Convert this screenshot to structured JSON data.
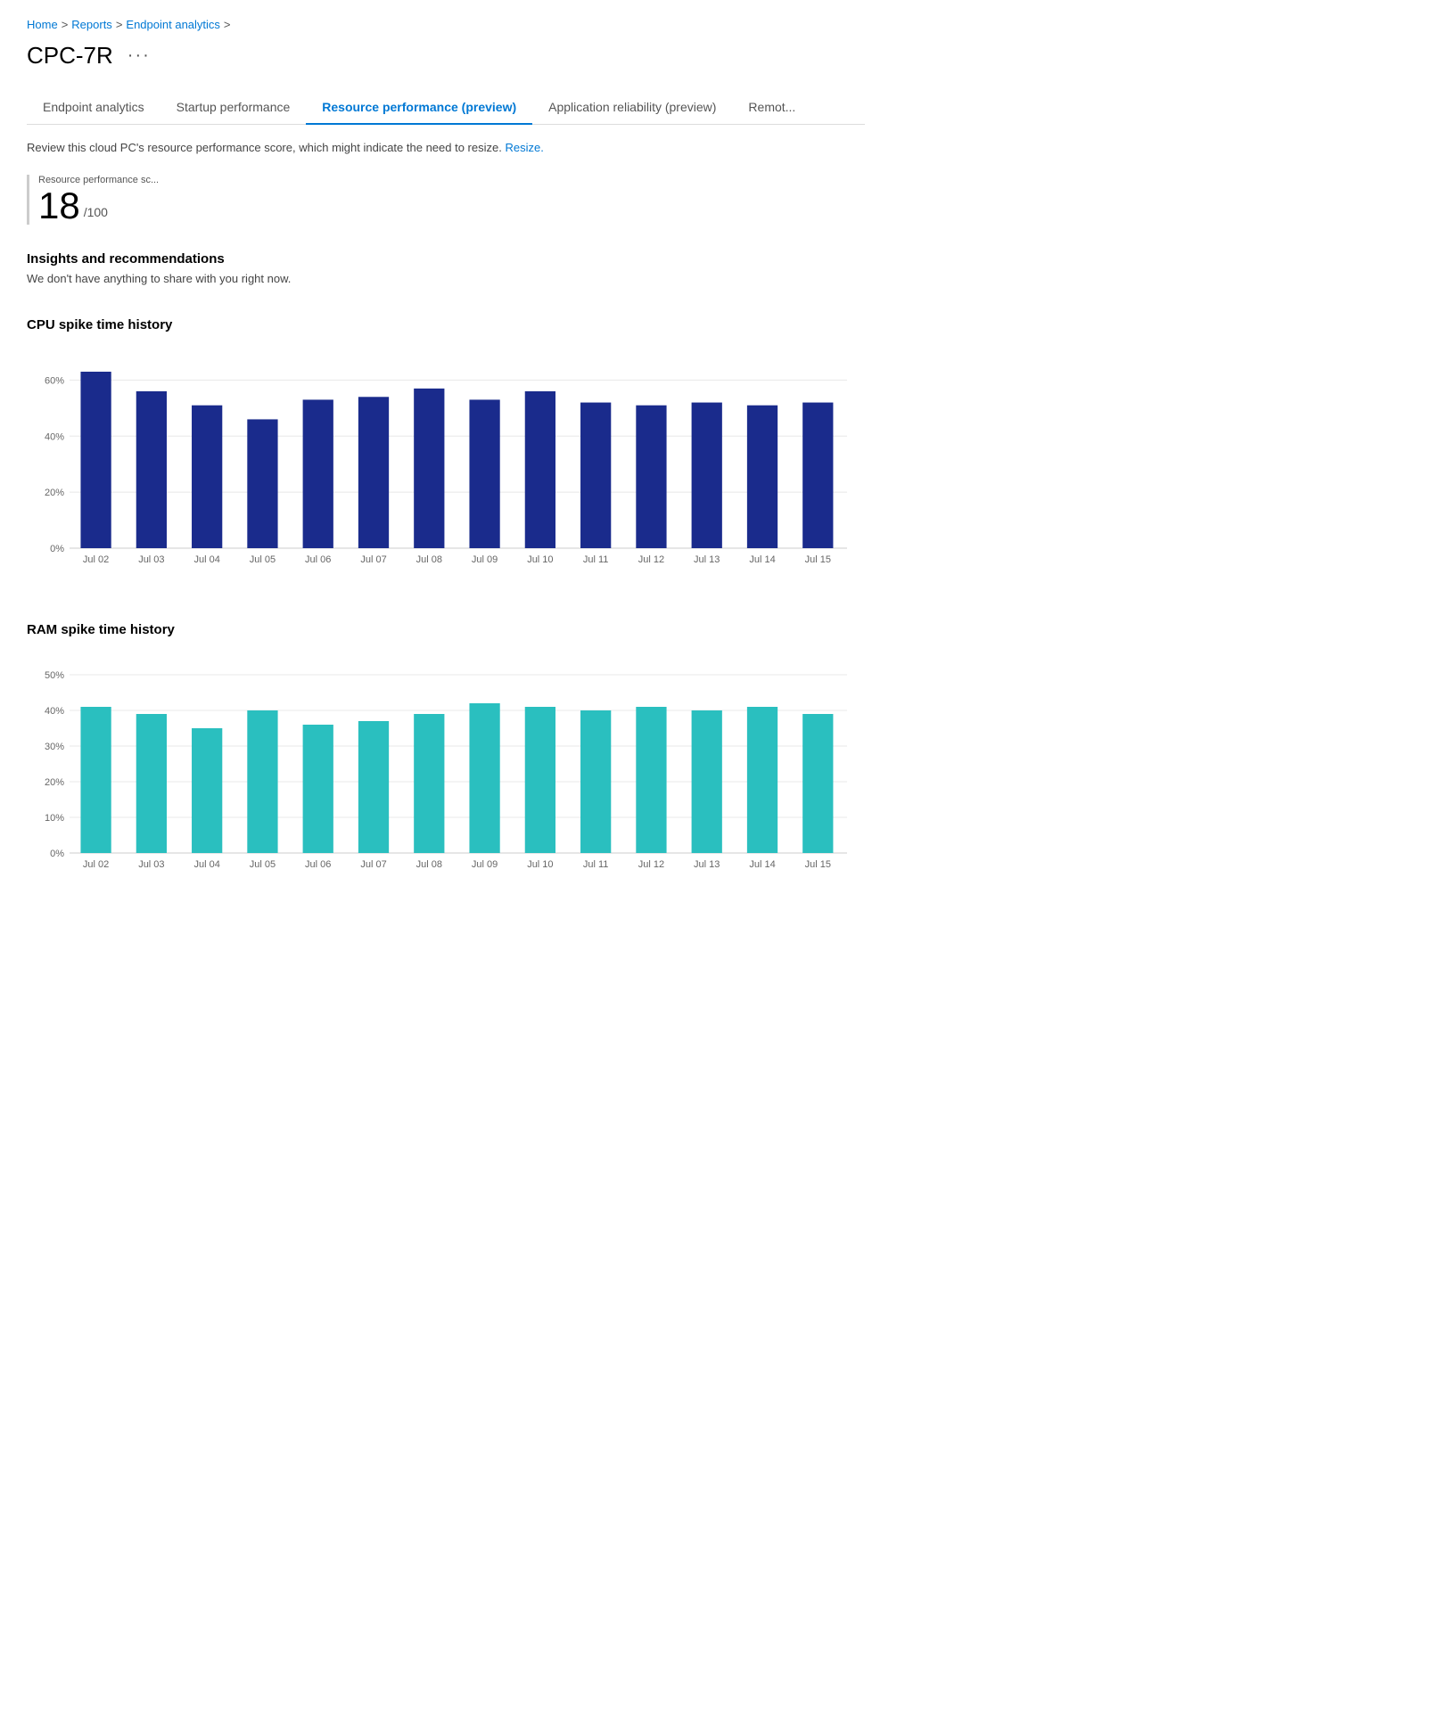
{
  "breadcrumb": {
    "items": [
      "Home",
      "Reports",
      "Endpoint analytics"
    ],
    "separators": [
      ">",
      ">",
      ">"
    ]
  },
  "page": {
    "title": "CPC-7R",
    "ellipsis": "···"
  },
  "tabs": [
    {
      "id": "endpoint-analytics",
      "label": "Endpoint analytics",
      "active": false
    },
    {
      "id": "startup-performance",
      "label": "Startup performance",
      "active": false
    },
    {
      "id": "resource-performance",
      "label": "Resource performance (preview)",
      "active": true
    },
    {
      "id": "application-reliability",
      "label": "Application reliability (preview)",
      "active": false
    },
    {
      "id": "remot",
      "label": "Remot...",
      "active": false
    }
  ],
  "description": {
    "text": "Review this cloud PC's resource performance score, which might indicate the need to resize.",
    "link_text": "Resize.",
    "link_href": "#"
  },
  "score": {
    "label": "Resource performance sc...",
    "value": "18",
    "denominator": "/100"
  },
  "insights": {
    "title": "Insights and recommendations",
    "text": "We don't have anything to share with you right now."
  },
  "cpu_chart": {
    "title": "CPU spike time history",
    "y_labels": [
      "60%",
      "40%",
      "20%",
      "0%"
    ],
    "y_max": 70,
    "bars": [
      {
        "label": "Jul 02",
        "value": 63
      },
      {
        "label": "Jul 03",
        "value": 56
      },
      {
        "label": "Jul 04",
        "value": 51
      },
      {
        "label": "Jul 05",
        "value": 46
      },
      {
        "label": "Jul 06",
        "value": 53
      },
      {
        "label": "Jul 07",
        "value": 54
      },
      {
        "label": "Jul 08",
        "value": 57
      },
      {
        "label": "Jul 09",
        "value": 53
      },
      {
        "label": "Jul 10",
        "value": 56
      },
      {
        "label": "Jul 11",
        "value": 52
      },
      {
        "label": "Jul 12",
        "value": 51
      },
      {
        "label": "Jul 13",
        "value": 52
      },
      {
        "label": "Jul 14",
        "value": 51
      },
      {
        "label": "Jul 15",
        "value": 52
      }
    ],
    "bar_color": "#1a2b8c"
  },
  "ram_chart": {
    "title": "RAM spike time history",
    "y_labels": [
      "50%",
      "40%",
      "30%",
      "20%",
      "10%",
      "0%"
    ],
    "y_max": 55,
    "bars": [
      {
        "label": "Jul 02",
        "value": 41
      },
      {
        "label": "Jul 03",
        "value": 39
      },
      {
        "label": "Jul 04",
        "value": 35
      },
      {
        "label": "Jul 05",
        "value": 40
      },
      {
        "label": "Jul 06",
        "value": 36
      },
      {
        "label": "Jul 07",
        "value": 37
      },
      {
        "label": "Jul 08",
        "value": 39
      },
      {
        "label": "Jul 09",
        "value": 42
      },
      {
        "label": "Jul 10",
        "value": 41
      },
      {
        "label": "Jul 11",
        "value": 40
      },
      {
        "label": "Jul 12",
        "value": 41
      },
      {
        "label": "Jul 13",
        "value": 40
      },
      {
        "label": "Jul 14",
        "value": 41
      },
      {
        "label": "Jul 15",
        "value": 39
      }
    ],
    "bar_color": "#2abfbf"
  }
}
